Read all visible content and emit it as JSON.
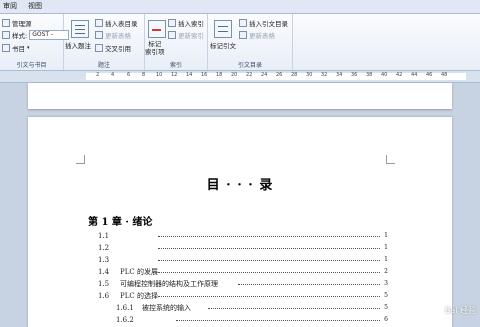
{
  "tabs": [
    "审阅",
    "视图"
  ],
  "ribbon": {
    "group1": {
      "manage_sources": "管理源",
      "style_label": "样式:",
      "style_value": "GOST - ",
      "bibliography": "书目",
      "label": "引文与书目"
    },
    "group2": {
      "insert_caption": "插入题注",
      "insert_toc_figures": "插入表目录",
      "update_table": "更新表格",
      "cross_ref": "交叉引用",
      "label": "题注"
    },
    "group3": {
      "mark_entry": "标记\n索引项",
      "insert_index": "插入索引",
      "update_index": "更新索引",
      "label": "索引"
    },
    "group4": {
      "mark_citation": "标记引文",
      "insert_toa": "插入引文目录",
      "update_table": "更新表格",
      "label": "引文目录"
    }
  },
  "ruler_numbers": [
    "2",
    "4",
    "6",
    "8",
    "10",
    "12",
    "14",
    "16",
    "18",
    "20",
    "22",
    "24",
    "26",
    "28",
    "30",
    "32",
    "34",
    "36",
    "38",
    "40",
    "42",
    "44",
    "46",
    "48"
  ],
  "document": {
    "toc_title": "目 · · · 录",
    "chapter": "第 1 章 · 绪论",
    "entries": [
      {
        "num": "1.1",
        "title": "",
        "page": "1"
      },
      {
        "num": "1.2",
        "title": "",
        "page": "1"
      },
      {
        "num": "1.3",
        "title": "",
        "page": "1"
      },
      {
        "num": "1.4",
        "title": "PLC 的发展",
        "page": "2"
      },
      {
        "num": "1.5",
        "title": "可编程控制器的结构及工作原理",
        "page": "3"
      },
      {
        "num": "1.6",
        "title": "PLC 的选择",
        "page": "5"
      },
      {
        "num": "1.6.1",
        "title": "被控系统的输入",
        "page": "5"
      },
      {
        "num": "1.6.2",
        "title": "",
        "page": "6"
      }
    ]
  },
  "watermark": "Bai 经验"
}
